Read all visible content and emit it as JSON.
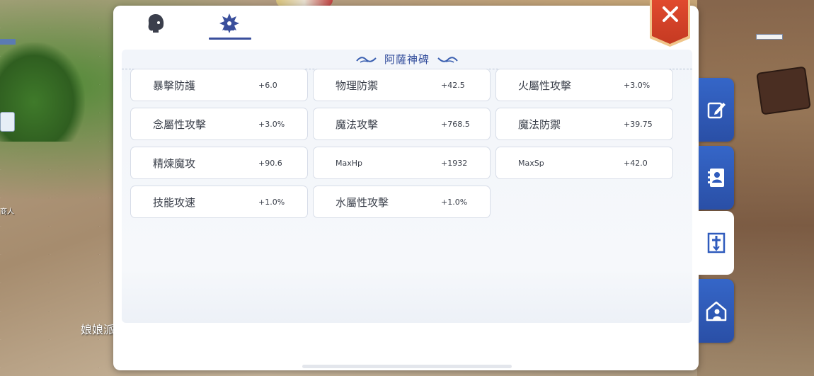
{
  "tabs": [
    {
      "icon": "character-profile-icon",
      "active": false
    },
    {
      "icon": "monument-icon",
      "active": true
    }
  ],
  "section": {
    "title": "阿薩神碑"
  },
  "stats": [
    {
      "name": "暴擊防護",
      "value": "+6.0"
    },
    {
      "name": "物理防禦",
      "value": "+42.5"
    },
    {
      "name": "火屬性攻擊",
      "value": "+3.0%"
    },
    {
      "name": "念屬性攻擊",
      "value": "+3.0%"
    },
    {
      "name": "魔法攻擊",
      "value": "+768.5"
    },
    {
      "name": "魔法防禦",
      "value": "+39.75"
    },
    {
      "name": "精煉魔攻",
      "value": "+90.6"
    },
    {
      "name": "MaxHp",
      "value": "+1932"
    },
    {
      "name": "MaxSp",
      "value": "+42.0"
    },
    {
      "name": "技能攻速",
      "value": "+1.0%"
    },
    {
      "name": "水屬性攻擊",
      "value": "+1.0%"
    }
  ],
  "side_nav": [
    {
      "icon": "edit-icon",
      "active": false
    },
    {
      "icon": "contact-book-icon",
      "active": false
    },
    {
      "icon": "cross-frame-icon",
      "active": true
    },
    {
      "icon": "home-user-icon",
      "active": false
    }
  ],
  "background": {
    "bottom_text": "娘娘派",
    "left_text": "商人"
  },
  "colors": {
    "accent": "#2f4a9a",
    "close": "#d9432a",
    "side_tab": "#2f5bbd"
  }
}
